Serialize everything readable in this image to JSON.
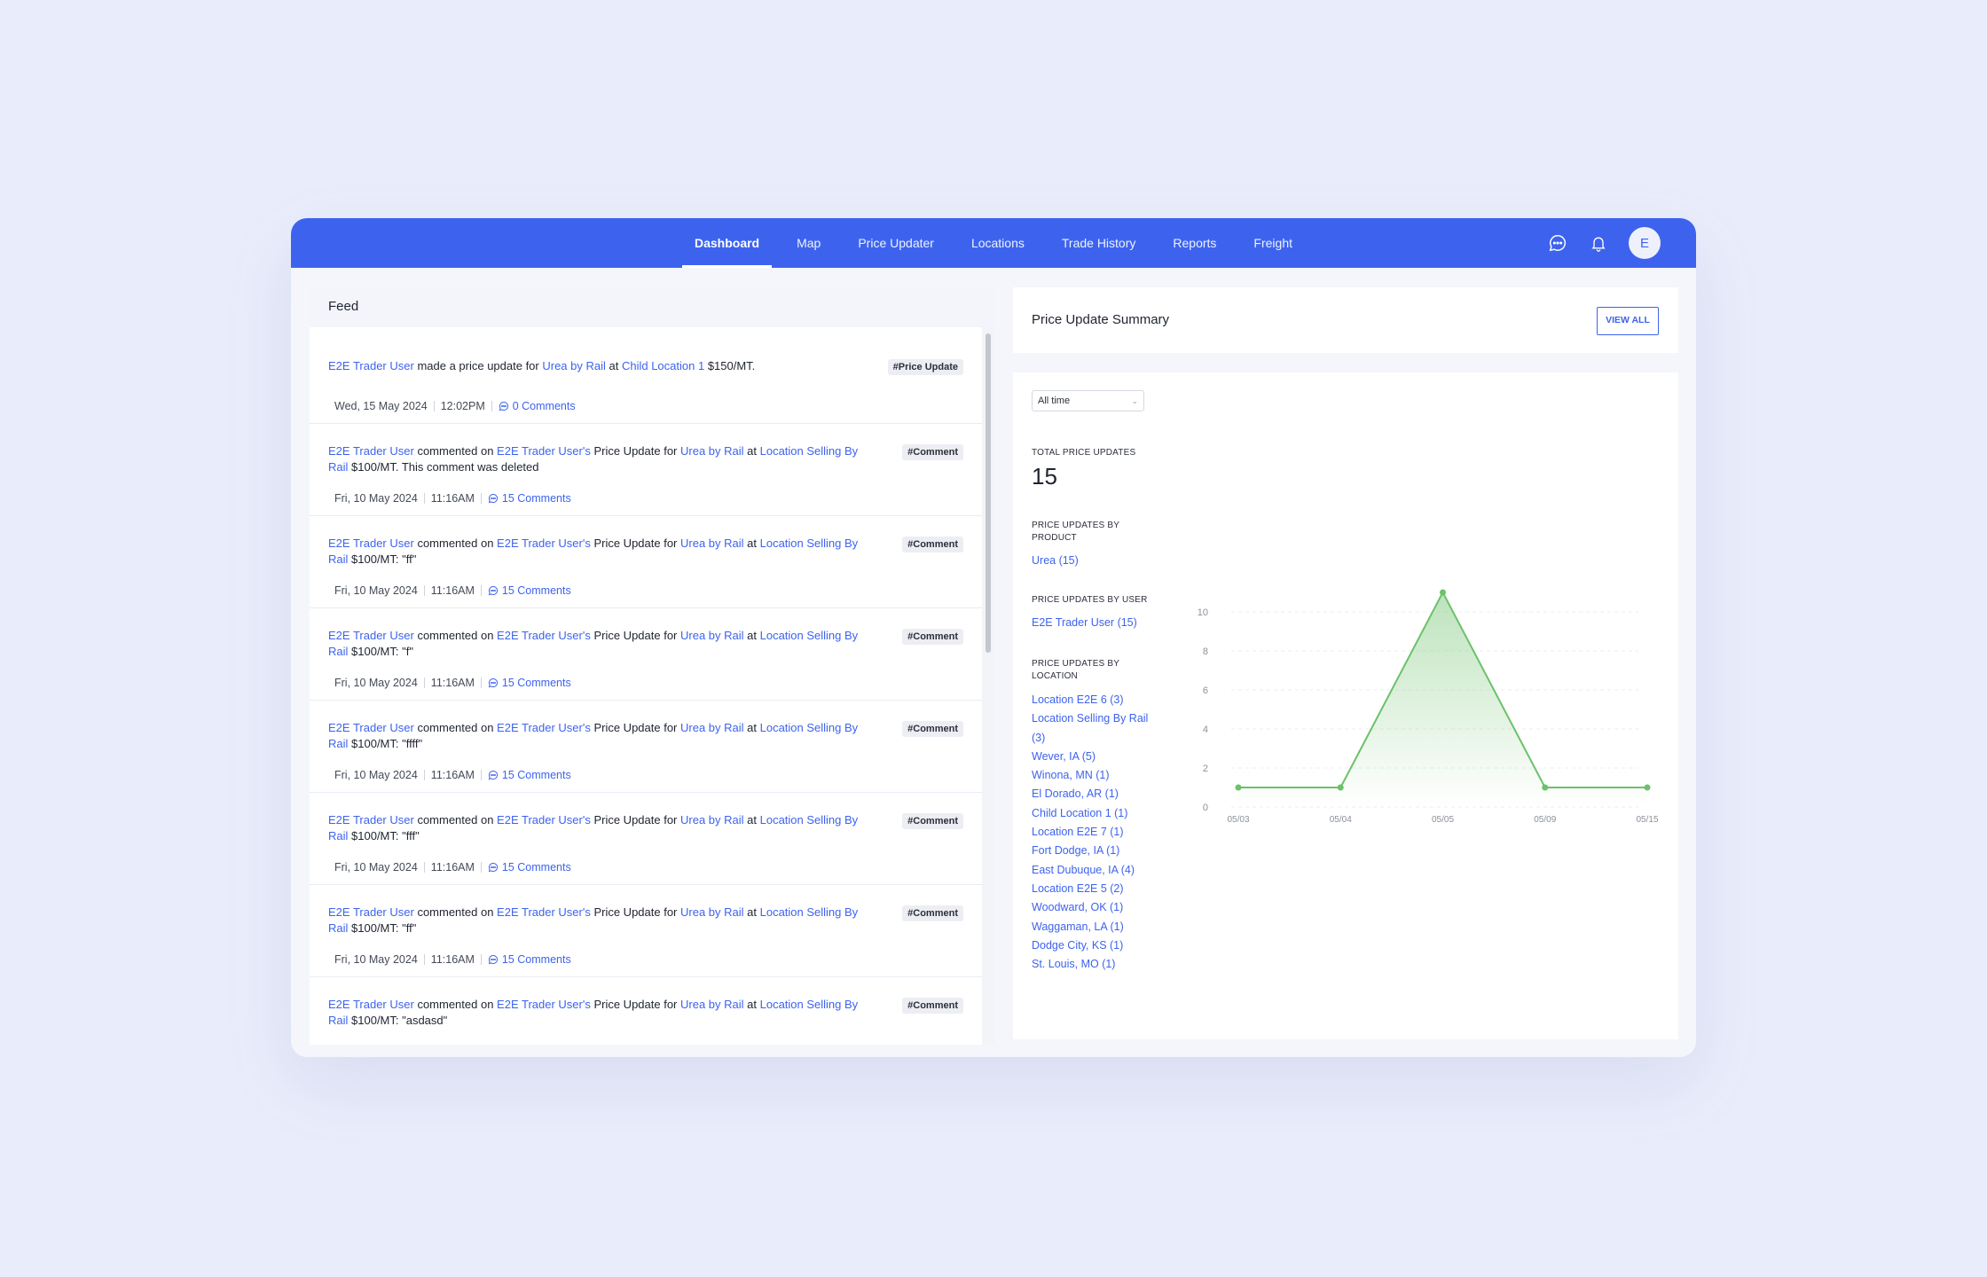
{
  "nav": {
    "tabs": [
      "Dashboard",
      "Map",
      "Price Updater",
      "Locations",
      "Trade History",
      "Reports",
      "Freight"
    ],
    "active_tab": "Dashboard",
    "avatar_initial": "E",
    "icons": [
      "chat-icon",
      "bell-icon"
    ]
  },
  "colors": {
    "brand": "#3d63ee",
    "chart_line": "#6cc16a"
  },
  "feed": {
    "title": "Feed",
    "items": [
      {
        "type": "price",
        "user": "E2E Trader User",
        "action": " made a price update for ",
        "product": "Urea by Rail",
        "at": " at ",
        "location": "Child Location 1",
        "suffix": " $150/MT.",
        "tag": "#Price Update",
        "date": "Wed, 15 May 2024",
        "time": "12:02PM",
        "comments": "0 Comments"
      },
      {
        "type": "comment",
        "user": "E2E Trader User",
        "action": " commented on ",
        "owner": "E2E Trader User's",
        "mid": " Price Update for ",
        "product": "Urea by Rail",
        "at": " at ",
        "location": "Location Selling By Rail",
        "suffix": " $100/MT. This comment was deleted",
        "tag": "#Comment",
        "date": "Fri, 10 May 2024",
        "time": "11:16AM",
        "comments": "15 Comments"
      },
      {
        "type": "comment",
        "user": "E2E Trader User",
        "action": " commented on ",
        "owner": "E2E Trader User's",
        "mid": " Price Update for ",
        "product": "Urea by Rail",
        "at": " at ",
        "location": "Location Selling By Rail",
        "suffix": " $100/MT: \"ff\"",
        "tag": "#Comment",
        "date": "Fri, 10 May 2024",
        "time": "11:16AM",
        "comments": "15 Comments"
      },
      {
        "type": "comment",
        "user": "E2E Trader User",
        "action": " commented on ",
        "owner": "E2E Trader User's",
        "mid": " Price Update for ",
        "product": "Urea by Rail",
        "at": " at ",
        "location": "Location Selling By Rail",
        "suffix": " $100/MT: \"f\"",
        "tag": "#Comment",
        "date": "Fri, 10 May 2024",
        "time": "11:16AM",
        "comments": "15 Comments"
      },
      {
        "type": "comment",
        "user": "E2E Trader User",
        "action": " commented on ",
        "owner": "E2E Trader User's",
        "mid": " Price Update for ",
        "product": "Urea by Rail",
        "at": " at ",
        "location": "Location Selling By Rail",
        "suffix": " $100/MT: \"ffff\"",
        "tag": "#Comment",
        "date": "Fri, 10 May 2024",
        "time": "11:16AM",
        "comments": "15 Comments"
      },
      {
        "type": "comment",
        "user": "E2E Trader User",
        "action": " commented on ",
        "owner": "E2E Trader User's",
        "mid": " Price Update for ",
        "product": "Urea by Rail",
        "at": " at ",
        "location": "Location Selling By Rail",
        "suffix": " $100/MT: \"fff\"",
        "tag": "#Comment",
        "date": "Fri, 10 May 2024",
        "time": "11:16AM",
        "comments": "15 Comments"
      },
      {
        "type": "comment",
        "user": "E2E Trader User",
        "action": " commented on ",
        "owner": "E2E Trader User's",
        "mid": " Price Update for ",
        "product": "Urea by Rail",
        "at": " at ",
        "location": "Location Selling By Rail",
        "suffix": " $100/MT: \"ff\"",
        "tag": "#Comment",
        "date": "Fri, 10 May 2024",
        "time": "11:16AM",
        "comments": "15 Comments"
      },
      {
        "type": "comment",
        "user": "E2E Trader User",
        "action": " commented on ",
        "owner": "E2E Trader User's",
        "mid": " Price Update for ",
        "product": "Urea by Rail",
        "at": " at ",
        "location": "Location Selling By Rail",
        "suffix": " $100/MT: \"asdasd\"",
        "tag": "#Comment",
        "date": "",
        "time": "",
        "comments": ""
      }
    ]
  },
  "summary": {
    "title": "Price Update Summary",
    "view_all": "VIEW ALL",
    "filter": "All time",
    "total_label": "TOTAL PRICE UPDATES",
    "total_value": "15",
    "by_product_label": "PRICE UPDATES BY PRODUCT",
    "by_product": [
      "Urea (15)"
    ],
    "by_user_label": "PRICE UPDATES BY USER",
    "by_user": [
      "E2E Trader User (15)"
    ],
    "by_location_label": "PRICE UPDATES BY LOCATION",
    "by_location": [
      "Location E2E 6 (3)",
      "Location Selling By Rail (3)",
      "Wever, IA (5)",
      "Winona, MN (1)",
      "El Dorado, AR (1)",
      "Child Location 1 (1)",
      "Location E2E 7 (1)",
      "Fort Dodge, IA (1)",
      "East Dubuque, IA (4)",
      "Location E2E 5 (2)",
      "Woodward, OK (1)",
      "Waggaman, LA (1)",
      "Dodge City, KS (1)",
      "St. Louis, MO (1)"
    ]
  },
  "chart_data": {
    "type": "area",
    "categories": [
      "05/03",
      "05/04",
      "05/05",
      "05/09",
      "05/15"
    ],
    "values": [
      1,
      1,
      11,
      1,
      1
    ],
    "ylim": [
      0,
      10
    ],
    "yticks": [
      0,
      2,
      4,
      6,
      8,
      10
    ],
    "grid": true,
    "legend": "none"
  }
}
